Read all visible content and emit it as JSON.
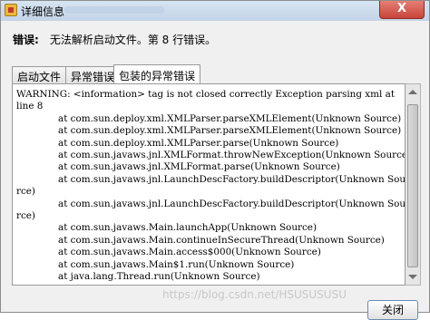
{
  "window": {
    "title": "详细信息",
    "close_label": "X"
  },
  "error": {
    "label": "错误:",
    "message": "无法解析启动文件。第 8 行错误。"
  },
  "tabs": [
    {
      "label": "启动文件",
      "active": false
    },
    {
      "label": "异常错误",
      "active": false
    },
    {
      "label": "包装的异常错误",
      "active": true
    }
  ],
  "details": {
    "lines": [
      {
        "text": "WARNING: <information> tag is not closed correctly Exception parsing xml at",
        "indent": false
      },
      {
        "text": " line 8",
        "indent": false
      },
      {
        "text": "at com.sun.deploy.xml.XMLParser.parseXMLElement(Unknown Source)",
        "indent": true
      },
      {
        "text": "at com.sun.deploy.xml.XMLParser.parseXMLElement(Unknown Source)",
        "indent": true
      },
      {
        "text": "at com.sun.deploy.xml.XMLParser.parse(Unknown Source)",
        "indent": true
      },
      {
        "text": "at com.sun.javaws.jnl.XMLFormat.throwNewException(Unknown Source)",
        "indent": true
      },
      {
        "text": "at com.sun.javaws.jnl.XMLFormat.parse(Unknown Source)",
        "indent": true
      },
      {
        "text": "at com.sun.javaws.jnl.LaunchDescFactory.buildDescriptor(Unknown Sou",
        "indent": true
      },
      {
        "text": "rce)",
        "indent": false
      },
      {
        "text": "at com.sun.javaws.jnl.LaunchDescFactory.buildDescriptor(Unknown Sou",
        "indent": true
      },
      {
        "text": "rce)",
        "indent": false
      },
      {
        "text": "at com.sun.javaws.Main.launchApp(Unknown Source)",
        "indent": true
      },
      {
        "text": "at com.sun.javaws.Main.continueInSecureThread(Unknown Source)",
        "indent": true
      },
      {
        "text": "at com.sun.javaws.Main.access$000(Unknown Source)",
        "indent": true
      },
      {
        "text": "at com.sun.javaws.Main$1.run(Unknown Source)",
        "indent": true
      },
      {
        "text": "at java.lang.Thread.run(Unknown Source)",
        "indent": true
      }
    ]
  },
  "watermark": "https://blog.csdn.net/HSUSUSUSU",
  "close_button": "关闭"
}
